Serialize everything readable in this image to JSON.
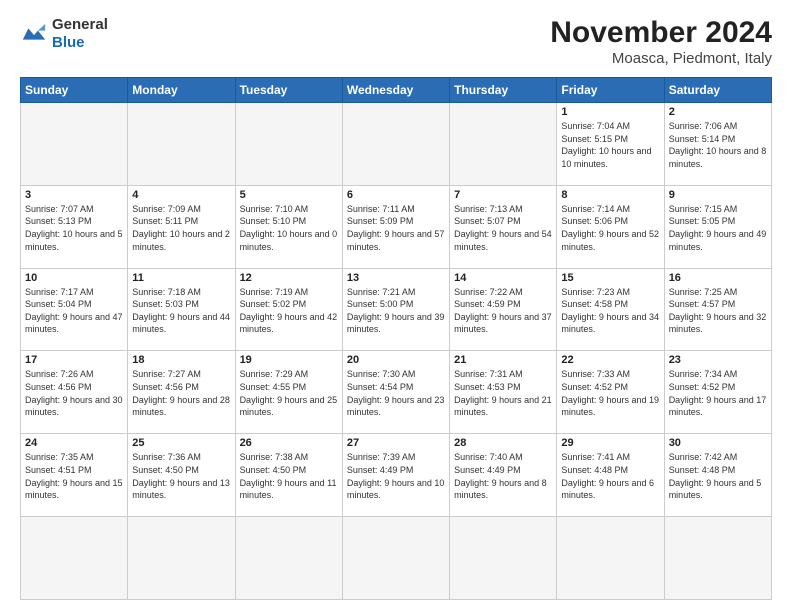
{
  "logo": {
    "general": "General",
    "blue": "Blue"
  },
  "title": "November 2024",
  "location": "Moasca, Piedmont, Italy",
  "weekdays": [
    "Sunday",
    "Monday",
    "Tuesday",
    "Wednesday",
    "Thursday",
    "Friday",
    "Saturday"
  ],
  "days": [
    {
      "num": "",
      "info": ""
    },
    {
      "num": "",
      "info": ""
    },
    {
      "num": "",
      "info": ""
    },
    {
      "num": "",
      "info": ""
    },
    {
      "num": "",
      "info": ""
    },
    {
      "num": "1",
      "info": "Sunrise: 7:04 AM\nSunset: 5:15 PM\nDaylight: 10 hours and 10 minutes."
    },
    {
      "num": "2",
      "info": "Sunrise: 7:06 AM\nSunset: 5:14 PM\nDaylight: 10 hours and 8 minutes."
    },
    {
      "num": "3",
      "info": "Sunrise: 7:07 AM\nSunset: 5:13 PM\nDaylight: 10 hours and 5 minutes."
    },
    {
      "num": "4",
      "info": "Sunrise: 7:09 AM\nSunset: 5:11 PM\nDaylight: 10 hours and 2 minutes."
    },
    {
      "num": "5",
      "info": "Sunrise: 7:10 AM\nSunset: 5:10 PM\nDaylight: 10 hours and 0 minutes."
    },
    {
      "num": "6",
      "info": "Sunrise: 7:11 AM\nSunset: 5:09 PM\nDaylight: 9 hours and 57 minutes."
    },
    {
      "num": "7",
      "info": "Sunrise: 7:13 AM\nSunset: 5:07 PM\nDaylight: 9 hours and 54 minutes."
    },
    {
      "num": "8",
      "info": "Sunrise: 7:14 AM\nSunset: 5:06 PM\nDaylight: 9 hours and 52 minutes."
    },
    {
      "num": "9",
      "info": "Sunrise: 7:15 AM\nSunset: 5:05 PM\nDaylight: 9 hours and 49 minutes."
    },
    {
      "num": "10",
      "info": "Sunrise: 7:17 AM\nSunset: 5:04 PM\nDaylight: 9 hours and 47 minutes."
    },
    {
      "num": "11",
      "info": "Sunrise: 7:18 AM\nSunset: 5:03 PM\nDaylight: 9 hours and 44 minutes."
    },
    {
      "num": "12",
      "info": "Sunrise: 7:19 AM\nSunset: 5:02 PM\nDaylight: 9 hours and 42 minutes."
    },
    {
      "num": "13",
      "info": "Sunrise: 7:21 AM\nSunset: 5:00 PM\nDaylight: 9 hours and 39 minutes."
    },
    {
      "num": "14",
      "info": "Sunrise: 7:22 AM\nSunset: 4:59 PM\nDaylight: 9 hours and 37 minutes."
    },
    {
      "num": "15",
      "info": "Sunrise: 7:23 AM\nSunset: 4:58 PM\nDaylight: 9 hours and 34 minutes."
    },
    {
      "num": "16",
      "info": "Sunrise: 7:25 AM\nSunset: 4:57 PM\nDaylight: 9 hours and 32 minutes."
    },
    {
      "num": "17",
      "info": "Sunrise: 7:26 AM\nSunset: 4:56 PM\nDaylight: 9 hours and 30 minutes."
    },
    {
      "num": "18",
      "info": "Sunrise: 7:27 AM\nSunset: 4:56 PM\nDaylight: 9 hours and 28 minutes."
    },
    {
      "num": "19",
      "info": "Sunrise: 7:29 AM\nSunset: 4:55 PM\nDaylight: 9 hours and 25 minutes."
    },
    {
      "num": "20",
      "info": "Sunrise: 7:30 AM\nSunset: 4:54 PM\nDaylight: 9 hours and 23 minutes."
    },
    {
      "num": "21",
      "info": "Sunrise: 7:31 AM\nSunset: 4:53 PM\nDaylight: 9 hours and 21 minutes."
    },
    {
      "num": "22",
      "info": "Sunrise: 7:33 AM\nSunset: 4:52 PM\nDaylight: 9 hours and 19 minutes."
    },
    {
      "num": "23",
      "info": "Sunrise: 7:34 AM\nSunset: 4:52 PM\nDaylight: 9 hours and 17 minutes."
    },
    {
      "num": "24",
      "info": "Sunrise: 7:35 AM\nSunset: 4:51 PM\nDaylight: 9 hours and 15 minutes."
    },
    {
      "num": "25",
      "info": "Sunrise: 7:36 AM\nSunset: 4:50 PM\nDaylight: 9 hours and 13 minutes."
    },
    {
      "num": "26",
      "info": "Sunrise: 7:38 AM\nSunset: 4:50 PM\nDaylight: 9 hours and 11 minutes."
    },
    {
      "num": "27",
      "info": "Sunrise: 7:39 AM\nSunset: 4:49 PM\nDaylight: 9 hours and 10 minutes."
    },
    {
      "num": "28",
      "info": "Sunrise: 7:40 AM\nSunset: 4:49 PM\nDaylight: 9 hours and 8 minutes."
    },
    {
      "num": "29",
      "info": "Sunrise: 7:41 AM\nSunset: 4:48 PM\nDaylight: 9 hours and 6 minutes."
    },
    {
      "num": "30",
      "info": "Sunrise: 7:42 AM\nSunset: 4:48 PM\nDaylight: 9 hours and 5 minutes."
    },
    {
      "num": "",
      "info": ""
    }
  ]
}
